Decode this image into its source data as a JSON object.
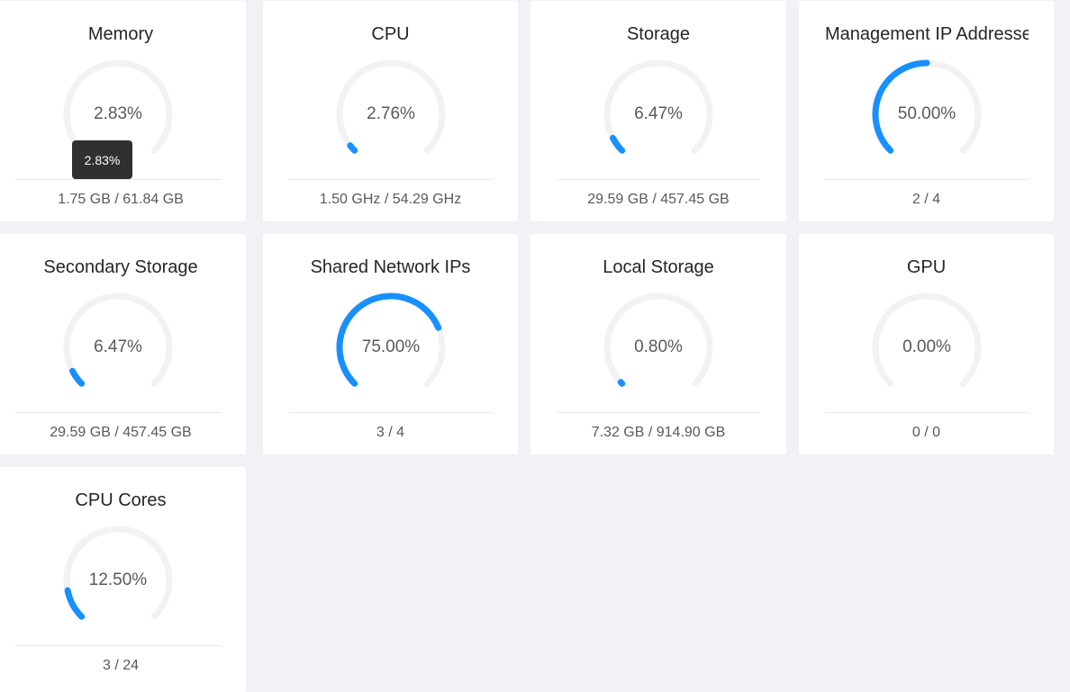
{
  "colors": {
    "accent": "#1890ff",
    "track": "#f2f2f2"
  },
  "cards": [
    {
      "title": "Memory",
      "percent": 2.83,
      "value_text": "2.83%",
      "footer": "1.75 GB / 61.84 GB",
      "tooltip": "2.83%"
    },
    {
      "title": "CPU",
      "percent": 2.76,
      "value_text": "2.76%",
      "footer": "1.50 GHz / 54.29 GHz"
    },
    {
      "title": "Storage",
      "percent": 6.47,
      "value_text": "6.47%",
      "footer": "29.59 GB / 457.45 GB"
    },
    {
      "title": "Management IP Addresse",
      "percent": 50.0,
      "value_text": "50.00%",
      "footer": "2 / 4"
    },
    {
      "title": "Secondary Storage",
      "percent": 6.47,
      "value_text": "6.47%",
      "footer": "29.59 GB / 457.45 GB"
    },
    {
      "title": "Shared Network IPs",
      "percent": 75.0,
      "value_text": "75.00%",
      "footer": "3 / 4"
    },
    {
      "title": "Local Storage",
      "percent": 0.8,
      "value_text": "0.80%",
      "footer": "7.32 GB / 914.90 GB"
    },
    {
      "title": "GPU",
      "percent": 0.0,
      "value_text": "0.00%",
      "footer": "0 / 0"
    },
    {
      "title": "CPU Cores",
      "percent": 12.5,
      "value_text": "12.50%",
      "footer": "3 / 24"
    }
  ]
}
